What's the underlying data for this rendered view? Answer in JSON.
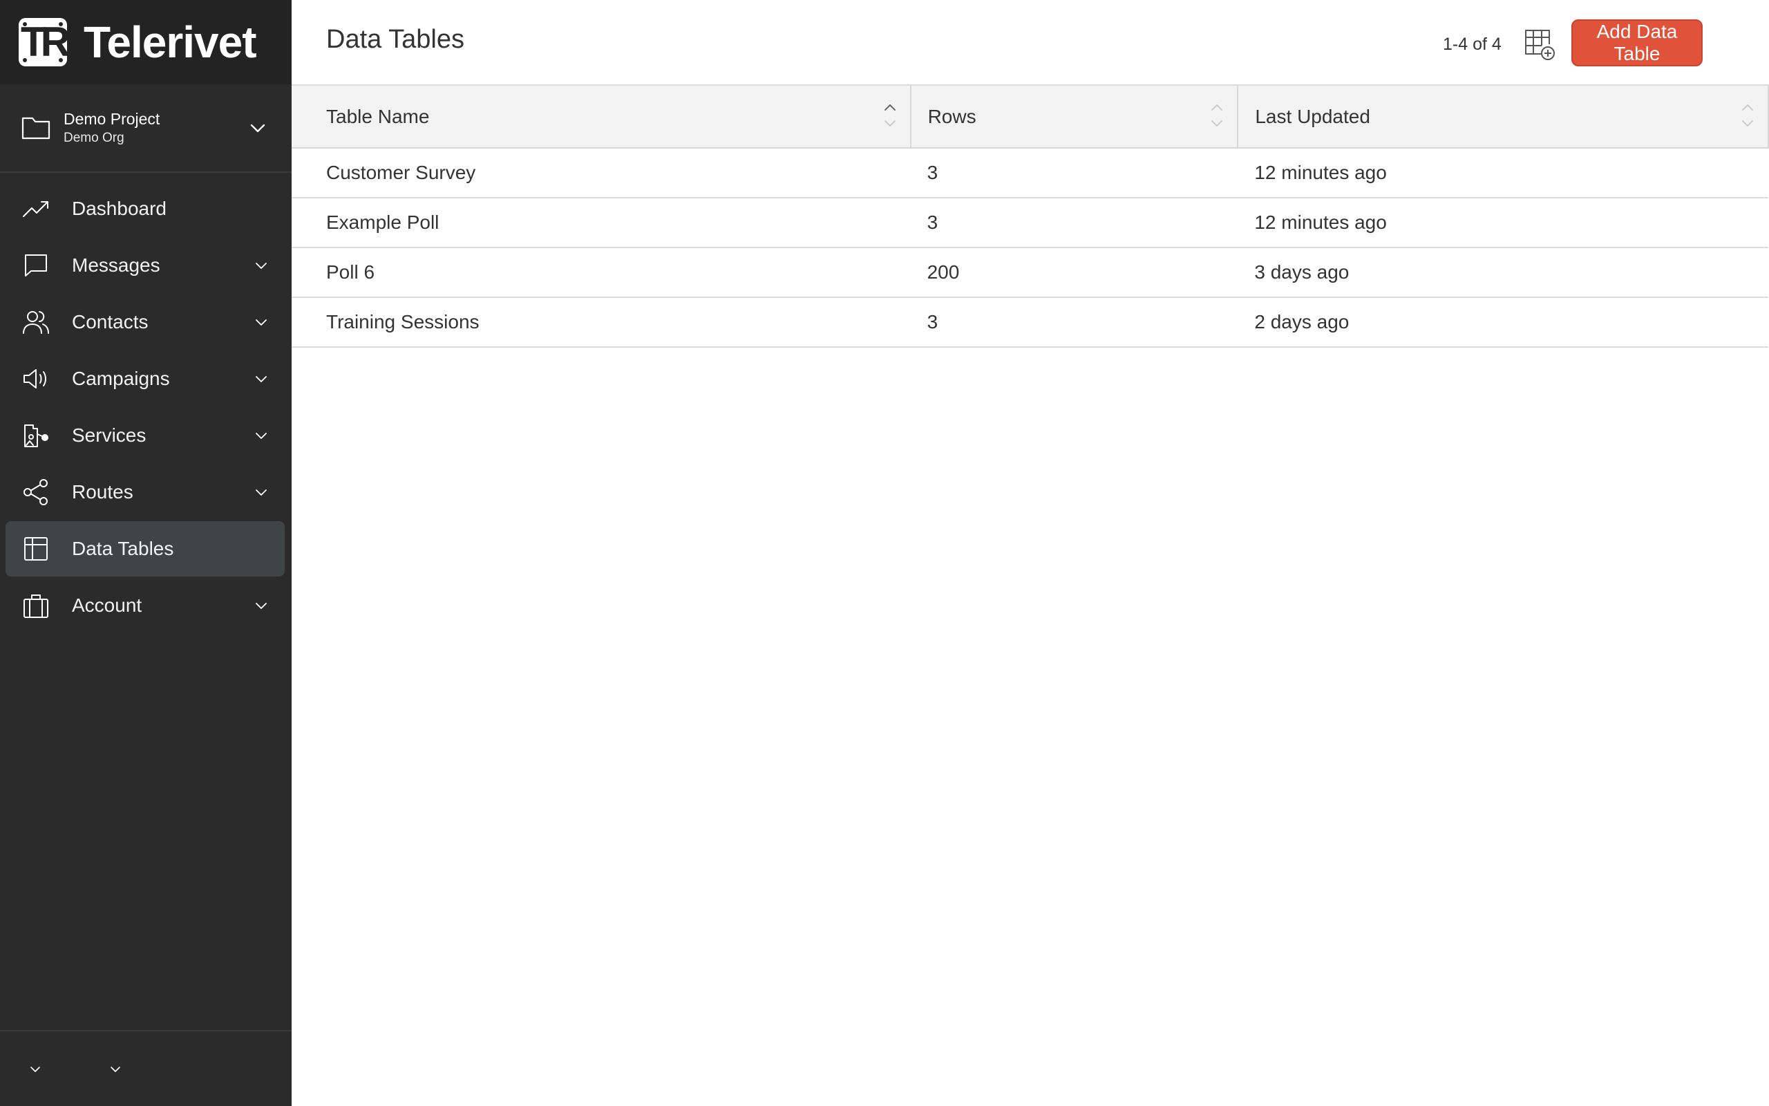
{
  "app": {
    "name": "Telerivet",
    "logo_letters": "TR"
  },
  "project": {
    "name": "Demo Project",
    "org": "Demo Org"
  },
  "sidebar": {
    "items": [
      {
        "label": "Dashboard",
        "icon": "trending-up-icon",
        "has_children": false,
        "active": false
      },
      {
        "label": "Messages",
        "icon": "message-icon",
        "has_children": true,
        "active": false
      },
      {
        "label": "Contacts",
        "icon": "users-icon",
        "has_children": true,
        "active": false
      },
      {
        "label": "Campaigns",
        "icon": "megaphone-icon",
        "has_children": true,
        "active": false
      },
      {
        "label": "Services",
        "icon": "services-icon",
        "has_children": true,
        "active": false
      },
      {
        "label": "Routes",
        "icon": "share-icon",
        "has_children": true,
        "active": false
      },
      {
        "label": "Data Tables",
        "icon": "table-icon",
        "has_children": false,
        "active": true
      },
      {
        "label": "Account",
        "icon": "briefcase-icon",
        "has_children": true,
        "active": false
      }
    ]
  },
  "header": {
    "title": "Data Tables",
    "count": "1-4 of 4",
    "add_button": "Add Data Table"
  },
  "table": {
    "columns": [
      "Table Name",
      "Rows",
      "Last Updated"
    ],
    "sort_column": "Table Name",
    "sort_direction": "ascending",
    "rows": [
      {
        "name": "Customer Survey",
        "rows": "3",
        "updated": "12 minutes ago"
      },
      {
        "name": "Example Poll",
        "rows": "3",
        "updated": "12 minutes ago"
      },
      {
        "name": "Poll 6",
        "rows": "200",
        "updated": "3 days ago"
      },
      {
        "name": "Training Sessions",
        "rows": "3",
        "updated": "2 days ago"
      }
    ]
  },
  "colors": {
    "sidebar_bg": "#2b2b2b",
    "logo_bar_bg": "#232323",
    "active_item_bg": "#3f4446",
    "accent": "#e0533a"
  }
}
